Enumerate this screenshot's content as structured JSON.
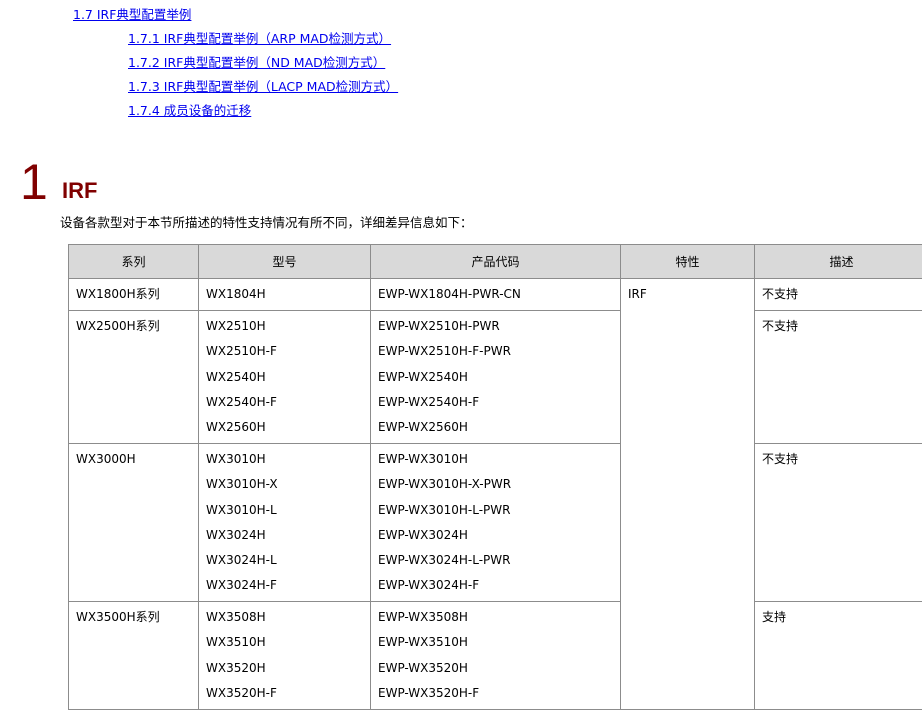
{
  "toc": [
    {
      "label": "1.7 IRF典型配置举例"
    },
    {
      "label": "1.7.1 IRF典型配置举例（ARP MAD检测方式）"
    },
    {
      "label": "1.7.2 IRF典型配置举例（ND MAD检测方式）"
    },
    {
      "label": "1.7.3 IRF典型配置举例（LACP MAD检测方式）"
    },
    {
      "label": "1.7.4 成员设备的迁移"
    }
  ],
  "chapter": {
    "number": "1",
    "title": "IRF",
    "intro": "设备各款型对于本节所描述的特性支持情况有所不同，详细差异信息如下："
  },
  "table": {
    "headers": [
      "系列",
      "型号",
      "产品代码",
      "特性",
      "描述"
    ],
    "feature": "IRF",
    "groups": [
      {
        "series": "WX1800H系列",
        "desc": "不支持",
        "models": [
          [
            "WX1804H",
            "EWP-WX1804H-PWR-CN"
          ]
        ]
      },
      {
        "series": "WX2500H系列",
        "desc": "不支持",
        "models": [
          [
            "WX2510H",
            "EWP-WX2510H-PWR"
          ],
          [
            "WX2510H-F",
            "EWP-WX2510H-F-PWR"
          ],
          [
            "WX2540H",
            "EWP-WX2540H"
          ],
          [
            "WX2540H-F",
            "EWP-WX2540H-F"
          ],
          [
            "WX2560H",
            "EWP-WX2560H"
          ]
        ]
      },
      {
        "series": "WX3000H",
        "desc": "不支持",
        "models": [
          [
            "WX3010H",
            "EWP-WX3010H"
          ],
          [
            "WX3010H-X",
            "EWP-WX3010H-X-PWR"
          ],
          [
            "WX3010H-L",
            "EWP-WX3010H-L-PWR"
          ],
          [
            "WX3024H",
            "EWP-WX3024H"
          ],
          [
            "WX3024H-L",
            "EWP-WX3024H-L-PWR"
          ],
          [
            "WX3024H-F",
            "EWP-WX3024H-F"
          ]
        ]
      },
      {
        "series": "WX3500H系列",
        "desc": "支持",
        "models": [
          [
            "WX3508H",
            "EWP-WX3508H"
          ],
          [
            "WX3510H",
            "EWP-WX3510H"
          ],
          [
            "WX3520H",
            "EWP-WX3520H"
          ],
          [
            "WX3520H-F",
            "EWP-WX3520H-F"
          ]
        ]
      }
    ]
  }
}
